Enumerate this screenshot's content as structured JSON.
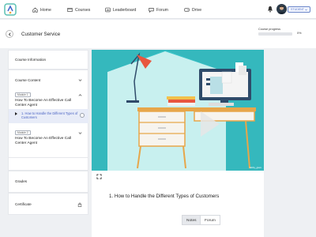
{
  "nav": {
    "items": [
      {
        "label": "Home",
        "icon": "home-icon"
      },
      {
        "label": "Courses",
        "icon": "courses-icon"
      },
      {
        "label": "Leaderboard",
        "icon": "leaderboard-icon"
      },
      {
        "label": "Forum",
        "icon": "forum-icon"
      },
      {
        "label": "Drive",
        "icon": "drive-icon"
      }
    ],
    "role_badge": "STUDENT",
    "notification_icon": "bell-icon",
    "brand_color": "#3e64c9"
  },
  "header": {
    "title": "Customer Service",
    "progress_label": "Course progress",
    "progress_value": 0,
    "progress_text": "0%"
  },
  "sidebar": {
    "course_information": "Course Information",
    "course_content": "Course Content",
    "modules": [
      {
        "badge": "Module 1",
        "title": "How To Become An Effective Call Center Agent",
        "lessons": [
          {
            "label": "1. How to Handle the Different Types of Customers",
            "active": true
          }
        ]
      },
      {
        "badge": "Module 2",
        "title": "How To Become An Effective Call Center Agent"
      }
    ],
    "grades": "Grades",
    "certificate": "Certificate"
  },
  "video": {
    "watermark": "fabby_gtwo"
  },
  "lesson": {
    "title": "1. How to Handle the Different Types of Customers",
    "tabs": [
      {
        "label": "Notes",
        "active": true
      },
      {
        "label": "Forum",
        "active": false
      }
    ]
  }
}
